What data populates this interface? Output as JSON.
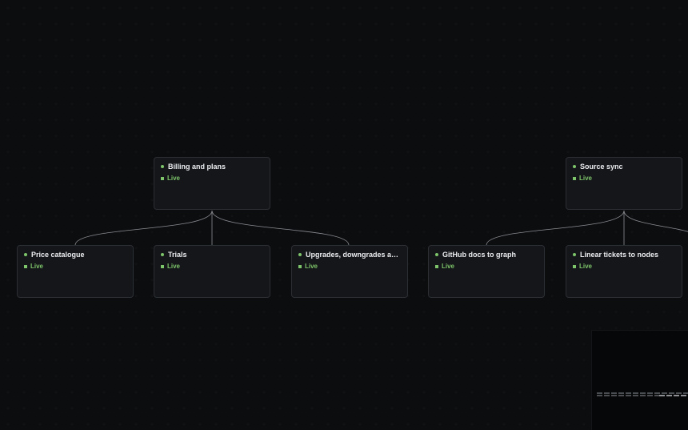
{
  "diagram": {
    "colors": {
      "background": "#0c0d0f",
      "node_bg": "#141619",
      "node_border": "#2b2e33",
      "edge": "#8a8d92",
      "live": "#7ec46a",
      "title": "#eceef0"
    },
    "nodes": [
      {
        "id": "billing",
        "title": "Billing and plans",
        "status": "Live"
      },
      {
        "id": "source",
        "title": "Source sync",
        "status": "Live"
      },
      {
        "id": "price",
        "title": "Price catalogue",
        "status": "Live"
      },
      {
        "id": "trials",
        "title": "Trials",
        "status": "Live"
      },
      {
        "id": "upgrades",
        "title": "Upgrades, downgrades and trials",
        "status": "Live"
      },
      {
        "id": "github",
        "title": "GitHub docs to graph",
        "status": "Live"
      },
      {
        "id": "linear",
        "title": "Linear tickets to nodes",
        "status": "Live"
      }
    ],
    "edges": [
      {
        "from": "billing",
        "to": "price"
      },
      {
        "from": "billing",
        "to": "trials"
      },
      {
        "from": "billing",
        "to": "upgrades"
      },
      {
        "from": "source",
        "to": "github"
      },
      {
        "from": "source",
        "to": "linear"
      },
      {
        "from": "source",
        "to": "offscreen"
      }
    ]
  }
}
